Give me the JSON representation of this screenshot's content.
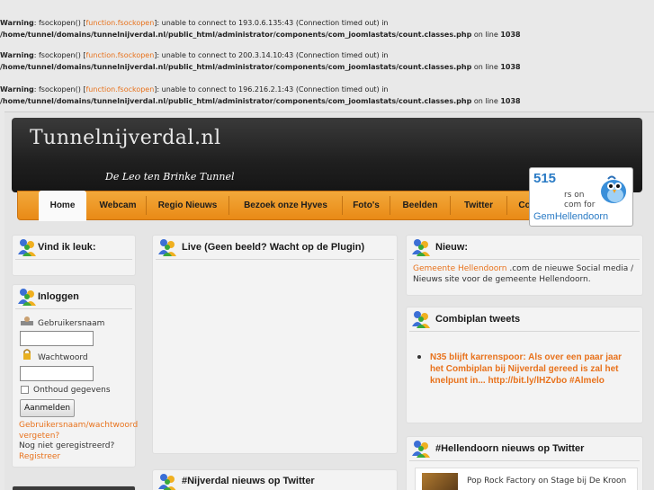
{
  "warnings": [
    {
      "label": "Warning",
      "pre": ": fsockopen() [",
      "fn": "function.fsockopen",
      "post": "]: unable to connect to 193.0.6.135:43 (Connection timed out) in",
      "path": "/home/tunnel/domains/tunnelnijverdal.nl/public_html/administrator/components/com_joomlastats/count.classes.php",
      "online": " on line ",
      "line": "1038"
    },
    {
      "label": "Warning",
      "pre": ": fsockopen() [",
      "fn": "function.fsockopen",
      "post": "]: unable to connect to 200.3.14.10:43 (Connection timed out) in",
      "path": "/home/tunnel/domains/tunnelnijverdal.nl/public_html/administrator/components/com_joomlastats/count.classes.php",
      "online": " on line ",
      "line": "1038"
    },
    {
      "label": "Warning",
      "pre": ": fsockopen() [",
      "fn": "function.fsockopen",
      "post": "]: unable to connect to 196.216.2.1:43 (Connection timed out) in",
      "path": "/home/tunnel/domains/tunnelnijverdal.nl/public_html/administrator/components/com_joomlastats/count.classes.php",
      "online": " on line ",
      "line": "1038"
    }
  ],
  "header": {
    "title": "Tunnelnijverdal.nl",
    "subtitle": "De Leo ten Brinke Tunnel"
  },
  "nav": {
    "items": [
      {
        "label": "Home"
      },
      {
        "label": "Webcam"
      },
      {
        "label": "Regio Nieuws"
      },
      {
        "label": "Bezoek onze Hyves"
      },
      {
        "label": "Foto's"
      },
      {
        "label": "Beelden"
      },
      {
        "label": "Twitter"
      },
      {
        "label": "Contact"
      }
    ]
  },
  "twitter_widget": {
    "count": "515",
    "text_line1": "rs on",
    "text_line2": "com for",
    "user": "GemHellendoorn"
  },
  "boxes": {
    "like": {
      "title": "Vind ik leuk:"
    },
    "login": {
      "title": "Inloggen",
      "username_label": "Gebruikersnaam",
      "password_label": "Wachtwoord",
      "remember_label": "Onthoud gegevens",
      "submit_label": "Aanmelden",
      "forgot_link": "Gebruikersnaam/wachtwoord vergeten?",
      "not_registered": "Nog niet geregistreerd?",
      "register_link": "Registreer"
    },
    "live": {
      "title": "Live (Geen beeld? Wacht op de Plugin)"
    },
    "nijverdal_twitter": {
      "title": "#Nijverdal nieuws op Twitter"
    },
    "news": {
      "title": "Nieuw:",
      "link": "Gemeente Hellendoorn",
      "text": " .com de nieuwe Social media / Nieuws site voor de gemeente Hellendoorn."
    },
    "combiplan": {
      "title": "Combiplan tweets",
      "tweet": "N35 blijft karrenspoor: Als over een paar jaar het Combiplan bij Nijverdal gereed is zal het knelpunt in... http://bit.ly/lHZvbo #Almelo"
    },
    "hellendoorn_twitter": {
      "title": "#Hellendoorn nieuws op Twitter",
      "item_text": "Pop Rock Factory on Stage bij De Kroon"
    }
  },
  "colors": {
    "accent_orange": "#e98a16",
    "link_orange": "#e8721c",
    "twitter_blue": "#2a7bc5"
  }
}
